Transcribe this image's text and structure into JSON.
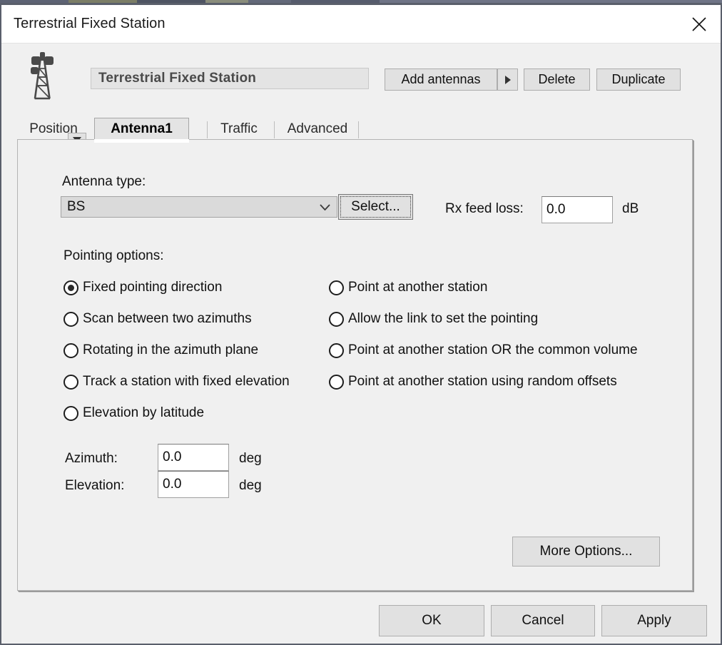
{
  "window": {
    "title": "Terrestrial Fixed Station",
    "close_icon": "close-icon"
  },
  "header": {
    "station_icon": "antenna-tower-icon",
    "station_dropdown_icon": "caret-down-icon",
    "station_name": "Terrestrial Fixed Station",
    "add_antennas_label": "Add antennas",
    "add_antennas_arrow_icon": "caret-right-icon",
    "delete_label": "Delete",
    "duplicate_label": "Duplicate"
  },
  "tabs": [
    {
      "label": "Position",
      "active": false
    },
    {
      "label": "Antenna1",
      "active": true
    },
    {
      "label": "Traffic",
      "active": false
    },
    {
      "label": "Advanced",
      "active": false
    }
  ],
  "antenna": {
    "type_label": "Antenna type:",
    "type_value": "BS",
    "type_chevron_icon": "chevron-down-icon",
    "select_label": "Select...",
    "rx_feed_loss_label": "Rx feed loss:",
    "rx_feed_loss_value": "0.0",
    "rx_feed_loss_unit": "dB"
  },
  "pointing": {
    "group_label": "Pointing options:",
    "left_options": [
      {
        "label": "Fixed pointing direction",
        "checked": true
      },
      {
        "label": "Scan between two azimuths",
        "checked": false
      },
      {
        "label": "Rotating in the azimuth plane",
        "checked": false
      },
      {
        "label": "Track a station with fixed elevation",
        "checked": false
      },
      {
        "label": "Elevation by latitude",
        "checked": false
      }
    ],
    "right_options": [
      {
        "label": "Point at another station",
        "checked": false
      },
      {
        "label": "Allow the link to set the pointing",
        "checked": false
      },
      {
        "label": "Point at another station OR the common volume",
        "checked": false
      },
      {
        "label": "Point at another station using random offsets",
        "checked": false
      }
    ]
  },
  "angles": {
    "azimuth_label": "Azimuth:",
    "azimuth_value": "0.0",
    "azimuth_unit": "deg",
    "elevation_label": "Elevation:",
    "elevation_value": "0.0",
    "elevation_unit": "deg"
  },
  "more_options_label": "More Options...",
  "footer": {
    "ok_label": "OK",
    "cancel_label": "Cancel",
    "apply_label": "Apply"
  },
  "colors": {
    "window_bg": "#f0f0f0",
    "titlebar_bg": "#ffffff",
    "button_face": "#e1e1e1",
    "frame_border": "#5a5f6b",
    "field_bg": "#ffffff",
    "disabled_field_bg": "#e4e4e4"
  }
}
